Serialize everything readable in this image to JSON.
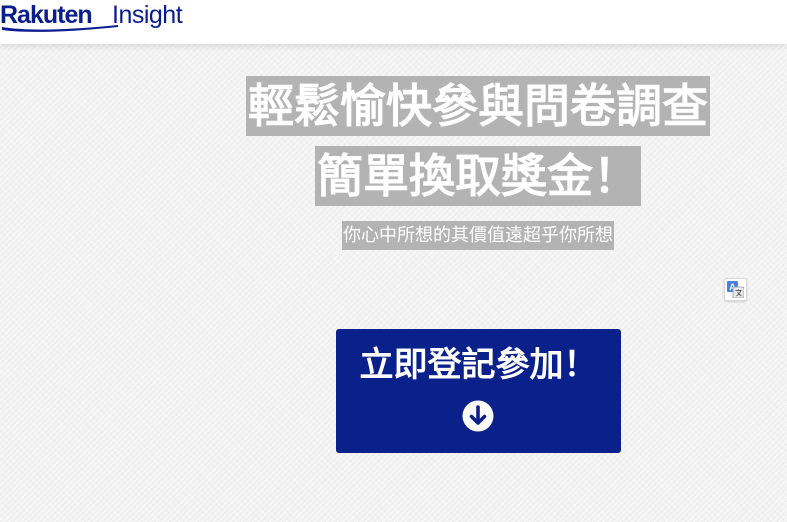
{
  "header": {
    "logo_text_primary": "Rakuten",
    "logo_text_secondary": "Insight",
    "brand_color": "#0a1d8f"
  },
  "hero": {
    "headline_line1": "輕鬆愉快參與問卷調查",
    "headline_line2": "簡單換取獎金！",
    "subtitle": "你心中所想的其價值遠超乎你所想",
    "text_highlight_color": "#b3b3b3"
  },
  "translate_widget": {
    "icon": "translate-icon"
  },
  "cta": {
    "label": "立即登記參加！",
    "icon": "arrow-down-circle-icon",
    "color": "#0a208a"
  }
}
